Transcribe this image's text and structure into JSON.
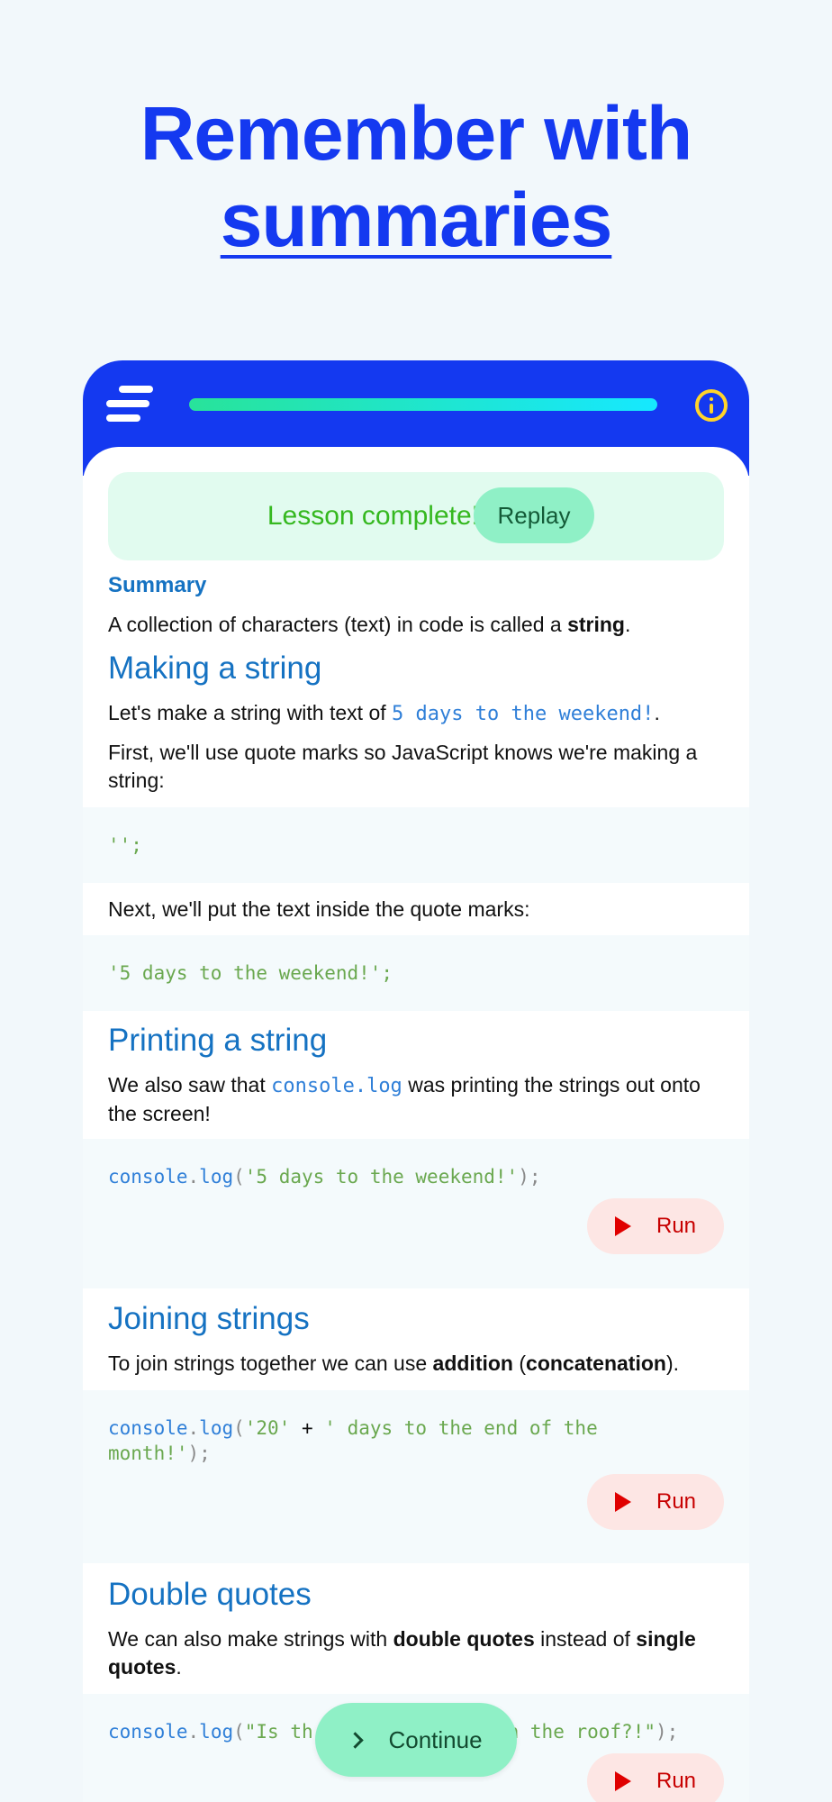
{
  "hero": {
    "line1": "Remember with",
    "line2": "summaries"
  },
  "topbar": {
    "menu_icon": "menu-icon",
    "info_icon": "info-icon",
    "progress": 1.0
  },
  "banner": {
    "text": "Lesson complete!",
    "replay": "Replay"
  },
  "summary_label": "Summary",
  "intro": {
    "text1": "A collection of characters (text) in code is called a ",
    "bold": "string",
    "end": "."
  },
  "s1": {
    "title": "Making a string",
    "p1_a": "Let's make a string with text of ",
    "p1_code": "5 days to the weekend!",
    "p1_end": ".",
    "p2": "First, we'll use quote marks so JavaScript knows we're making a string:",
    "code1": "'';",
    "p3": "Next, we'll put the text inside the quote marks:",
    "code2": "'5 days to the weekend!';"
  },
  "s2": {
    "title": "Printing a string",
    "p1_a": "We also saw that ",
    "p1_code": "console.log",
    "p1_b": " was printing the strings out onto the screen!",
    "code_fn": "console",
    "code_dot": ".",
    "code_method": "log",
    "code_open": "(",
    "code_str": "'5 days to the weekend!'",
    "code_close": ");",
    "run": "Run"
  },
  "s3": {
    "title": "Joining strings",
    "p1_a": "To join strings together we can use ",
    "bold1": "addition",
    "p1_b": " (",
    "bold2": "concatenation",
    "p1_c": ").",
    "code_fn": "console",
    "code_dot": ".",
    "code_method": "log",
    "code_open": "(",
    "code_str1": "'20'",
    "code_plus": " + ",
    "code_str2": "' days to the end of the month!'",
    "code_close": ");",
    "run": "Run"
  },
  "s4": {
    "title": "Double quotes",
    "p1_a": "We can also make strings with ",
    "bold1": "double quotes",
    "p1_b": " instead of ",
    "bold2": "single quotes",
    "p1_c": ".",
    "code_fn": "console",
    "code_dot": ".",
    "code_method": "log",
    "code_open": "(",
    "code_str": "\"Is th",
    "code_str_tail": "n the roof?!\"",
    "code_close": ");",
    "run": "Run"
  },
  "continue": "Continue",
  "colors": {
    "brand_blue": "#1439f0",
    "heading_blue": "#1572c2",
    "success_green": "#35b81f",
    "run_red": "#e00000"
  }
}
